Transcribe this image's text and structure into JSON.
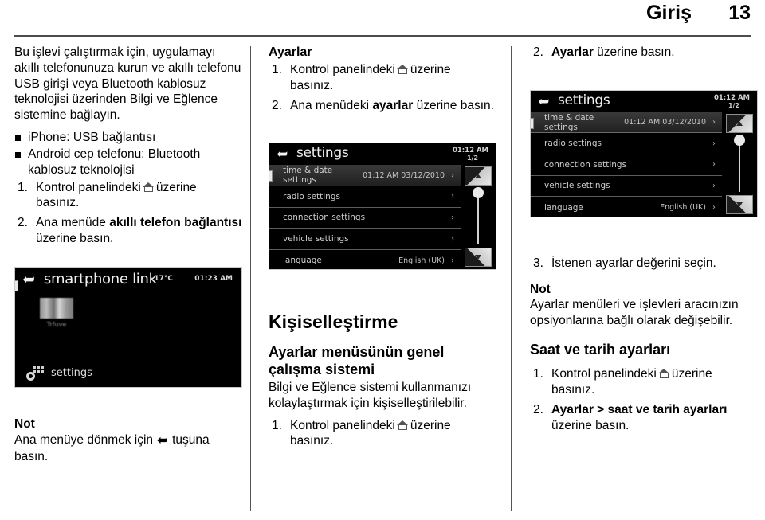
{
  "header": {
    "title": "Giriş",
    "page_number": "13"
  },
  "icons": {
    "home": "home-icon",
    "back": "back-arrow-icon"
  },
  "left_column": {
    "intro_paragraph": "Bu işlevi çalıştırmak için, uygulamayı akıllı telefonunuza kurun ve akıllı telefonu USB girişi veya Bluetooth kablosuz teknolojisi üzerinden Bilgi ve Eğlence sistemine bağlayın.",
    "bullets": [
      "iPhone: USB bağlantısı",
      "Android cep telefonu: Bluetooth kablosuz teknolojisi"
    ],
    "steps": [
      {
        "num": "1.",
        "text_before": "Kontrol panelindeki",
        "icon": "home-icon",
        "text_after": "üzerine basınız.",
        "bold": ""
      },
      {
        "num": "2.",
        "text_before": "Ana menüde",
        "bold": "akıllı telefon bağlantısı",
        "text_after": "üzerine basın."
      }
    ],
    "device": {
      "name": "smartphone-link-screen",
      "back_icon": "back-arrow-icon",
      "title": "smartphone link",
      "temperature": "-17°C",
      "clock": "01:23 AM",
      "app_label": "Trfuve",
      "settings_label": "settings"
    },
    "note": {
      "label": "Not",
      "text_before": "Ana menüye dönmek için",
      "icon": "back-arrow-icon",
      "text_after": "tuşuna basın."
    }
  },
  "mid_column": {
    "section_title": "Ayarlar",
    "steps": [
      {
        "num": "1.",
        "text_before": "Kontrol panelindeki",
        "icon": "home-icon",
        "text_after": "üzerine basınız."
      },
      {
        "num": "2.",
        "text_before": "Ana menüdeki",
        "bold": "ayarlar",
        "text_after": "üzerine basın."
      }
    ],
    "device": {
      "name": "settings-screen",
      "back_icon": "back-arrow-icon",
      "title": "settings",
      "clock": "01:12 AM",
      "paging": "1/2",
      "rows": [
        {
          "label": "time & date settings",
          "value": "01:12 AM   03/12/2010",
          "arrow": "›",
          "highlight": true
        },
        {
          "label": "radio settings",
          "value": "",
          "arrow": "›",
          "highlight": false
        },
        {
          "label": "connection settings",
          "value": "",
          "arrow": "›",
          "highlight": false
        },
        {
          "label": "vehicle settings",
          "value": "",
          "arrow": "›",
          "highlight": false
        },
        {
          "label": "language",
          "value": "English (UK)",
          "arrow": "›",
          "highlight": false
        }
      ]
    },
    "chapter_title": "Kişiselleştirme",
    "sub_title": "Ayarlar menüsünün genel çalışma sistemi",
    "paragraph": "Bilgi ve Eğlence sistemi kullanmanızı kolaylaştırmak için kişiselleştirilebilir.",
    "final_step": {
      "num": "1.",
      "text_before": "Kontrol panelindeki",
      "icon": "home-icon",
      "text_after": "üzerine basınız."
    }
  },
  "right_column": {
    "top_step": {
      "num": "2.",
      "bold": "Ayarlar",
      "text_after": "üzerine basın."
    },
    "device": {
      "name": "settings-screen",
      "back_icon": "back-arrow-icon",
      "title": "settings",
      "clock": "01:12 AM",
      "paging": "1/2",
      "rows": [
        {
          "label": "time & date settings",
          "value": "01:12 AM   03/12/2010",
          "arrow": "›",
          "highlight": true
        },
        {
          "label": "radio settings",
          "value": "",
          "arrow": "›",
          "highlight": false
        },
        {
          "label": "connection settings",
          "value": "",
          "arrow": "›",
          "highlight": false
        },
        {
          "label": "vehicle settings",
          "value": "",
          "arrow": "›",
          "highlight": false
        },
        {
          "label": "language",
          "value": "English (UK)",
          "arrow": "›",
          "highlight": false
        }
      ]
    },
    "step3": {
      "num": "3.",
      "text": "İstenen ayarlar değerini seçin."
    },
    "note": {
      "label": "Not",
      "text": "Ayarlar menüleri ve işlevleri aracınızın opsiyonlarına bağlı olarak değişebilir."
    },
    "sub_title": "Saat ve tarih ayarları",
    "steps": [
      {
        "num": "1.",
        "text_before": "Kontrol panelindeki",
        "icon": "home-icon",
        "text_after": "üzerine basınız."
      },
      {
        "num": "2.",
        "bold": "Ayarlar > saat ve tarih ayarları",
        "text_after": "üzerine basın."
      }
    ]
  }
}
